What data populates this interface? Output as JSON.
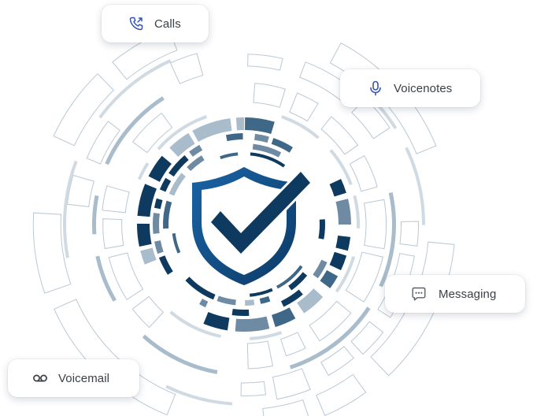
{
  "chips": {
    "calls": {
      "label": "Calls",
      "icon": "phone-call-icon"
    },
    "voicenotes": {
      "label": "Voicenotes",
      "icon": "microphone-icon"
    },
    "messaging": {
      "label": "Messaging",
      "icon": "chat-bubble-icon"
    },
    "voicemail": {
      "label": "Voicemail",
      "icon": "voicemail-icon"
    }
  },
  "center": {
    "icon": "shield-check-icon"
  },
  "colors": {
    "dark_navy": "#0f3a5f",
    "mid_blue": "#3f6787",
    "slate": "#6f8aa3",
    "light_slate": "#a9bccb",
    "pale": "#cfdae3",
    "outline": "#b9c8d4",
    "shield_blue": "#13558f",
    "icon_blue": "#3552b8",
    "chip_text": "#3a3f47"
  }
}
